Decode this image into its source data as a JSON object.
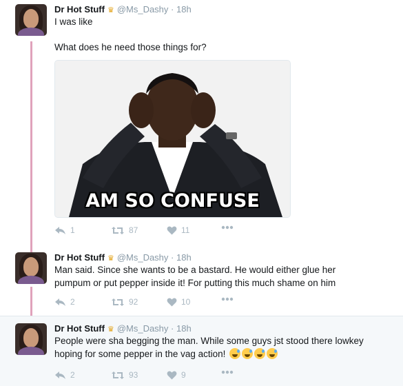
{
  "colors": {
    "thread_line": "#e0a2bb",
    "muted": "#8899a6",
    "icon": "#aab8c2",
    "crown": "#e3a41c",
    "highlight_bg": "#f5f8fa"
  },
  "tweets": [
    {
      "author_name": "Dr Hot Stuff",
      "verified_badge": "crown-icon",
      "handle": "@Ms_Dashy",
      "separator": "·",
      "time": "18h",
      "text_line1": "I was like",
      "text_line2": "What does he need those things for?",
      "media": {
        "caption": "AM SO CONFUSE"
      },
      "replies": "1",
      "retweets": "87",
      "likes": "11"
    },
    {
      "author_name": "Dr Hot Stuff",
      "verified_badge": "crown-icon",
      "handle": "@Ms_Dashy",
      "separator": "·",
      "time": "18h",
      "text": "Man said. Since she wants to be a bastard. He would either glue her pumpum or put pepper inside it! For putting this much shame on him",
      "replies": "2",
      "retweets": "92",
      "likes": "10"
    },
    {
      "author_name": "Dr Hot Stuff",
      "verified_badge": "crown-icon",
      "handle": "@Ms_Dashy",
      "separator": "·",
      "time": "18h",
      "text": "People were sha begging the man. While some guys jst stood there lowkey hoping for some pepper in the vag action!",
      "emoji_icon": "grinning-sweat-emoji",
      "replies": "2",
      "retweets": "93",
      "likes": "9"
    }
  ]
}
